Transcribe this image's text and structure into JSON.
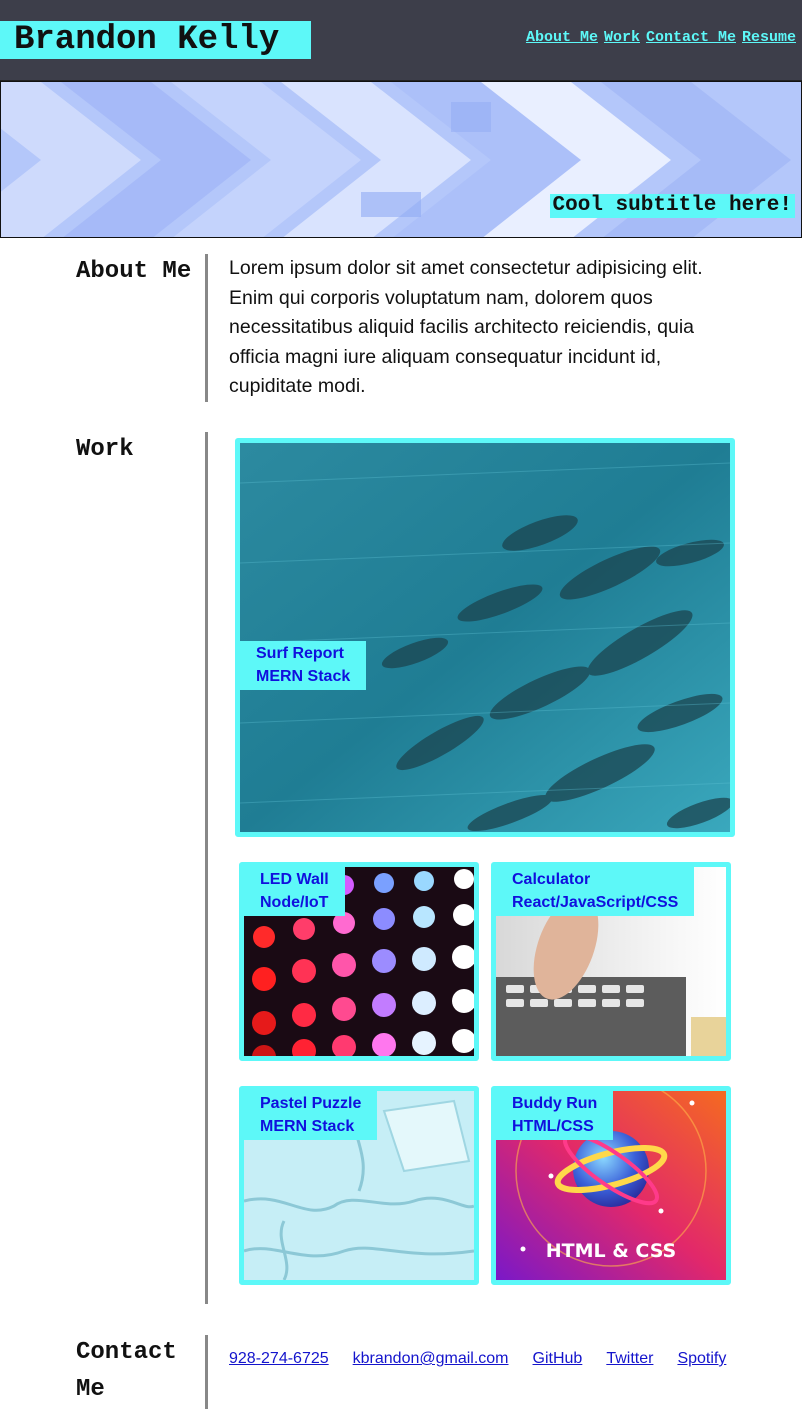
{
  "header": {
    "brand": "Brandon Kelly",
    "nav": [
      "About Me",
      "Work",
      "Contact Me",
      "Resume"
    ]
  },
  "hero": {
    "subtitle": "Cool subtitle here!"
  },
  "about": {
    "title": "About Me",
    "text": "Lorem ipsum dolor sit amet consectetur adipisicing elit. Enim qui corporis voluptatum nam, dolorem quos necessitatibus aliquid facilis architecto reiciendis, quia officia magni iure aliquam consequatur incidunt id, cupiditate modi."
  },
  "work": {
    "title": "Work",
    "projects": [
      {
        "name": "Surf Report",
        "stack": "MERN Stack"
      },
      {
        "name": "LED Wall",
        "stack": "Node/IoT"
      },
      {
        "name": "Calculator",
        "stack": "React/JavaScript/CSS"
      },
      {
        "name": "Pastel Puzzle",
        "stack": "MERN Stack"
      },
      {
        "name": "Buddy Run",
        "stack": "HTML/CSS",
        "image_text": "HTML & CSS"
      }
    ]
  },
  "contact": {
    "title": "Contact Me",
    "links": [
      "928-274-6725",
      "kbrandon@gmail.com",
      "GitHub",
      "Twitter",
      "Spotify"
    ]
  },
  "colors": {
    "header_bg": "#3d3e4a",
    "accent": "#5df8f8",
    "link_blue": "#1414cc"
  }
}
